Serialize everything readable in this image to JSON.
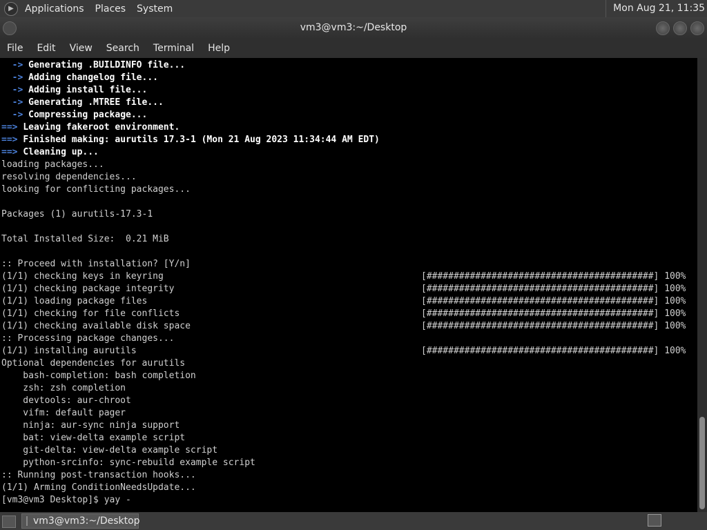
{
  "top_panel": {
    "menus": [
      "Applications",
      "Places",
      "System"
    ],
    "clock": "Mon Aug 21, 11:35"
  },
  "window": {
    "title": "vm3@vm3:~/Desktop",
    "menubar": [
      "File",
      "Edit",
      "View",
      "Search",
      "Terminal",
      "Help"
    ]
  },
  "terminal": {
    "lines": [
      {
        "prefix": "  -> ",
        "text": "Generating .BUILDINFO file...",
        "style": "arrow"
      },
      {
        "prefix": "  -> ",
        "text": "Adding changelog file...",
        "style": "arrow"
      },
      {
        "prefix": "  -> ",
        "text": "Adding install file...",
        "style": "arrow"
      },
      {
        "prefix": "  -> ",
        "text": "Generating .MTREE file...",
        "style": "arrow"
      },
      {
        "prefix": "  -> ",
        "text": "Compressing package...",
        "style": "arrow"
      },
      {
        "prefix": "==> ",
        "text": "Leaving fakeroot environment.",
        "style": "arrow"
      },
      {
        "prefix": "==> ",
        "text": "Finished making: aurutils 17.3-1 (Mon 21 Aug 2023 11:34:44 AM EDT)",
        "style": "arrow"
      },
      {
        "prefix": "==> ",
        "text": "Cleaning up...",
        "style": "arrow"
      },
      {
        "text": "loading packages..."
      },
      {
        "text": "resolving dependencies..."
      },
      {
        "text": "looking for conflicting packages..."
      },
      {
        "text": ""
      },
      {
        "text": "Packages (1) aurutils-17.3-1"
      },
      {
        "text": ""
      },
      {
        "text": "Total Installed Size:  0.21 MiB"
      },
      {
        "text": ""
      },
      {
        "text": ":: Proceed with installation? [Y/n]"
      },
      {
        "text": "(1/1) checking keys in keyring",
        "bar": "[##########################################] 100%"
      },
      {
        "text": "(1/1) checking package integrity",
        "bar": "[##########################################] 100%"
      },
      {
        "text": "(1/1) loading package files",
        "bar": "[##########################################] 100%"
      },
      {
        "text": "(1/1) checking for file conflicts",
        "bar": "[##########################################] 100%"
      },
      {
        "text": "(1/1) checking available disk space",
        "bar": "[##########################################] 100%"
      },
      {
        "text": ":: Processing package changes..."
      },
      {
        "text": "(1/1) installing aurutils",
        "bar": "[##########################################] 100%"
      },
      {
        "text": "Optional dependencies for aurutils"
      },
      {
        "text": "    bash-completion: bash completion"
      },
      {
        "text": "    zsh: zsh completion"
      },
      {
        "text": "    devtools: aur-chroot"
      },
      {
        "text": "    vifm: default pager"
      },
      {
        "text": "    ninja: aur-sync ninja support"
      },
      {
        "text": "    bat: view-delta example script"
      },
      {
        "text": "    git-delta: view-delta example script"
      },
      {
        "text": "    python-srcinfo: sync-rebuild example script"
      },
      {
        "text": ":: Running post-transaction hooks..."
      },
      {
        "text": "(1/1) Arming ConditionNeedsUpdate..."
      },
      {
        "text": "[vm3@vm3 Desktop]$ yay -"
      }
    ]
  },
  "taskbar": {
    "task_label": "vm3@vm3:~/Desktop"
  }
}
